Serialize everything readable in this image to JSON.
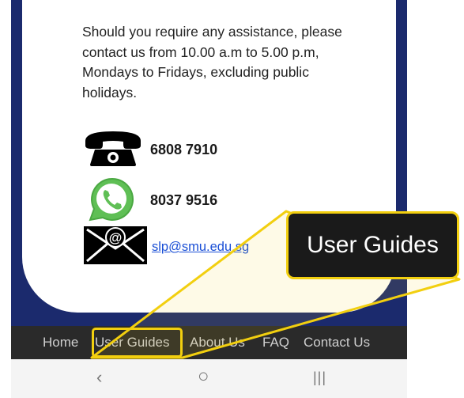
{
  "info_text": "Should you require any assistance, please contact us from 10.00 a.m to 5.00 p.m, Mondays to Fridays, excluding public holidays.",
  "contacts": {
    "phone": "6808 7910",
    "whatsapp": "8037 9516",
    "email": "slp@smu.edu.sg"
  },
  "nav": [
    "Home",
    "User Guides",
    "About Us",
    "FAQ",
    "Contact Us"
  ],
  "callout_label": "User Guides",
  "system_nav": {
    "back": "‹",
    "home": "○",
    "recents": "|||"
  },
  "icons": [
    "telephone-icon",
    "whatsapp-icon",
    "email-envelope-icon"
  ],
  "colors": {
    "background_blue": "#1b2a6d",
    "nav_bar": "#2a2a2a",
    "highlight": "#f2cf0f",
    "callout_bg": "#1a1a1a"
  }
}
